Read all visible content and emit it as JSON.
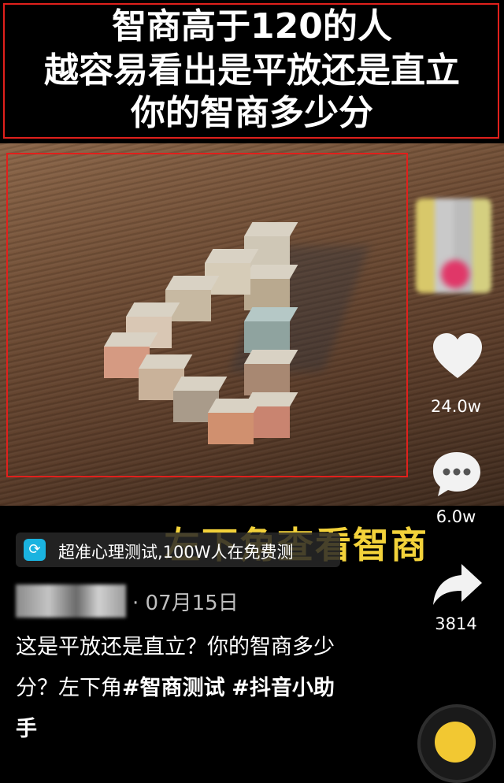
{
  "banner": {
    "line1": "智商高于120的人",
    "line2": "越容易看出是平放还是直立",
    "line3": "你的智商多少分"
  },
  "overlay": {
    "text": "左下角查看智商"
  },
  "actions": {
    "like_count": "24.0w",
    "comment_count": "6.0w",
    "share_count": "3814"
  },
  "promo": {
    "text": "超准心理测试,100W人在免费测"
  },
  "post": {
    "date": "· 07月15日",
    "description": "这是平放还是直立？你的智商多少分？左下角",
    "tag1": "#智商测试",
    "tag2": "#抖音小助手"
  },
  "colors": {
    "frame": "#e0201c",
    "overlay": "#f3d23a",
    "promo_icon": "#1ab3e0"
  },
  "icons": [
    "heart-icon",
    "comment-bubble-icon",
    "share-arrow-icon",
    "music-disc-icon"
  ]
}
